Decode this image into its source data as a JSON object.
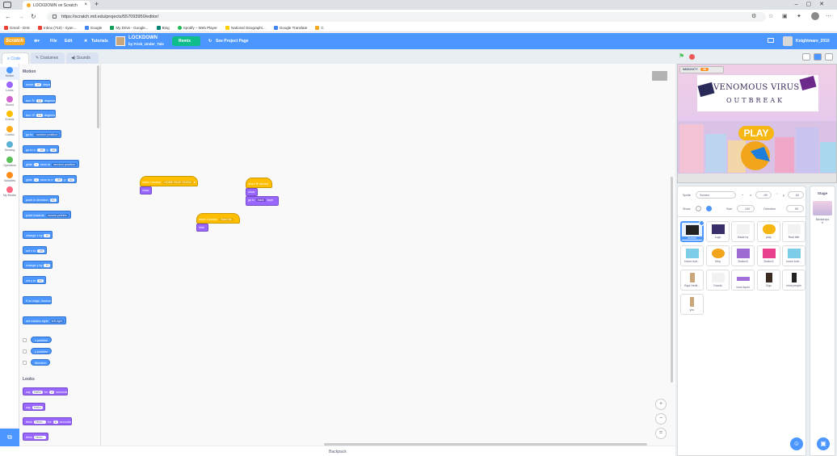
{
  "browser": {
    "tab_title": "LOCKDOWN on Scratch",
    "url": "https://scratch.mit.edu/projects/557093950/editor/",
    "bookmarks": [
      "Gmail - GIIS",
      "Inbox (710) - riyan...",
      "Google",
      "My Drive - Google...",
      "Bing",
      "Spotify – Web Player",
      "National Geographi...",
      "Google Translate",
      "C"
    ]
  },
  "menubar": {
    "logo": "Scratch",
    "file": "File",
    "edit": "Edit",
    "tutorials": "Tutorials",
    "project_title": "LOCKDOWN",
    "project_by": "by Frisk_Under_Tale",
    "remix": "Remix",
    "see_project": "See Project Page",
    "username": "Knightmare_2010"
  },
  "editor_tabs": {
    "code": "Code",
    "costumes": "Costumes",
    "sounds": "Sounds"
  },
  "categories": [
    {
      "label": "Motion",
      "color": "#4c97ff"
    },
    {
      "label": "Looks",
      "color": "#9966ff"
    },
    {
      "label": "Sound",
      "color": "#cf63cf"
    },
    {
      "label": "Events",
      "color": "#ffbf00"
    },
    {
      "label": "Control",
      "color": "#ffab19"
    },
    {
      "label": "Sensing",
      "color": "#5cb1d6"
    },
    {
      "label": "Operators",
      "color": "#59c059"
    },
    {
      "label": "Variables",
      "color": "#ff8c1a"
    },
    {
      "label": "My Blocks",
      "color": "#ff6680"
    }
  ],
  "palette": {
    "motion_header": "Motion",
    "looks_header": "Looks",
    "move": {
      "a": "move",
      "v": "10",
      "b": "steps"
    },
    "turn_right": {
      "a": "turn",
      "v": "15",
      "b": "degrees"
    },
    "turn_left": {
      "a": "turn",
      "v": "15",
      "b": "degrees"
    },
    "goto": {
      "a": "go to",
      "d": "random position"
    },
    "gotoxy": {
      "a": "go to x:",
      "x": "-99",
      "b": "y:",
      "y": "62"
    },
    "glide1": {
      "a": "glide",
      "v": "1",
      "b": "secs to",
      "d": "random position"
    },
    "glide2": {
      "a": "glide",
      "v": "1",
      "b": "secs to x:",
      "x": "-99",
      "c": "y:",
      "y": "62"
    },
    "point_dir": {
      "a": "point in direction",
      "v": "90"
    },
    "point_towards": {
      "a": "point towards",
      "d": "mouse-pointer"
    },
    "change_x": {
      "a": "change x by",
      "v": "10"
    },
    "set_x": {
      "a": "set x to",
      "v": "-99"
    },
    "change_y": {
      "a": "change y by",
      "v": "10"
    },
    "set_y": {
      "a": "set y to",
      "v": "62"
    },
    "bounce": "if on edge, bounce",
    "rotation": {
      "a": "set rotation style",
      "d": "left-right"
    },
    "xpos": "x position",
    "ypos": "y position",
    "direction": "direction",
    "say_for": {
      "a": "say",
      "v": "Hello!",
      "b": "for",
      "n": "2",
      "c": "seconds"
    },
    "say": {
      "a": "say",
      "v": "Hello!"
    },
    "think_for": {
      "a": "think",
      "v": "Hmm...",
      "b": "for",
      "n": "2",
      "c": "seconds"
    },
    "think": {
      "a": "think",
      "v": "Hmm..."
    }
  },
  "scripts": {
    "s1_hat": "when I receive",
    "s1_msg": "HOME PAGE SHOW",
    "s1_b1": "show",
    "s2_hat": "when",
    "s2_hatval": "clicked",
    "s2_b1": "show",
    "s2_b2a": "go to",
    "s2_b2d": "back",
    "s2_b2b": "layer",
    "s3_hat": "when I receive",
    "s3_msg": "Start the",
    "s3_b1": "hide"
  },
  "backpack": "Backpack",
  "stage": {
    "var_name": "IMMUNITY",
    "var_value": "28",
    "title_line1": "VENOMOUS VIRUS",
    "title_line2": "OUTBREAK",
    "play": "PLAY"
  },
  "sprite_info": {
    "sprite_label": "Sprite",
    "sprite_name": "Screen",
    "x_label": "x",
    "x": "-99",
    "y_label": "y",
    "y": "62",
    "show_label": "Show",
    "size_label": "Size",
    "size": "100",
    "direction_label": "Direction",
    "direction": "90"
  },
  "sprites": [
    {
      "name": "Screen",
      "color": "#222222",
      "selected": true
    },
    {
      "name": "Logo",
      "color": "#3a2f6a"
    },
    {
      "name": "Made by",
      "color": "#ffffff"
    },
    {
      "name": "play",
      "color": "#f6b712"
    },
    {
      "name": "Real title",
      "color": "#ffffff"
    },
    {
      "name": "Home butt...",
      "color": "#7ecde8"
    },
    {
      "name": "Help",
      "color": "#f2a51a"
    },
    {
      "name": "Button3",
      "color": "#9d6bd1"
    },
    {
      "name": "Button2",
      "color": "#e83e8c"
    },
    {
      "name": "home butt...",
      "color": "#7ecde8"
    },
    {
      "name": "Giga Hedit...",
      "color": "#c9a77a"
    },
    {
      "name": "Clouds",
      "color": "#ffffff"
    },
    {
      "name": "virus liquid",
      "color": "#a070d6"
    },
    {
      "name": "Gigu",
      "color": "#3b2a20"
    },
    {
      "name": "virus people",
      "color": "#222222"
    },
    {
      "name": "you",
      "color": "#c9a77a"
    }
  ],
  "stage_panel": {
    "title": "Stage",
    "backdrops_label": "Backdrops",
    "backdrops_count": "6"
  }
}
